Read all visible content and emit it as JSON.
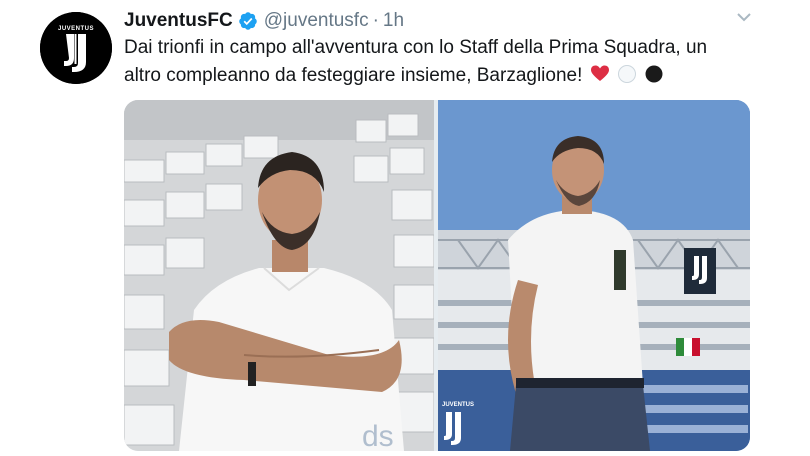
{
  "tweet": {
    "display_name": "JuventusFC",
    "handle": "@juventusfc",
    "separator": "·",
    "time": "1h",
    "text_line1": "Dai trionfi in campo all'avventura con lo Staff della Prima Squadra, un",
    "text_line2": "altro compleanno da festeggiare insieme, Barzaglione!",
    "verified_color": "#1da1f2",
    "emojis": [
      "red-heart",
      "white-circle",
      "black-circle"
    ],
    "avatar_text": "JUVENTUS"
  },
  "media": {
    "left_photo_overlay": "ds",
    "right_photo_logo_text": "JUVENTUS"
  }
}
